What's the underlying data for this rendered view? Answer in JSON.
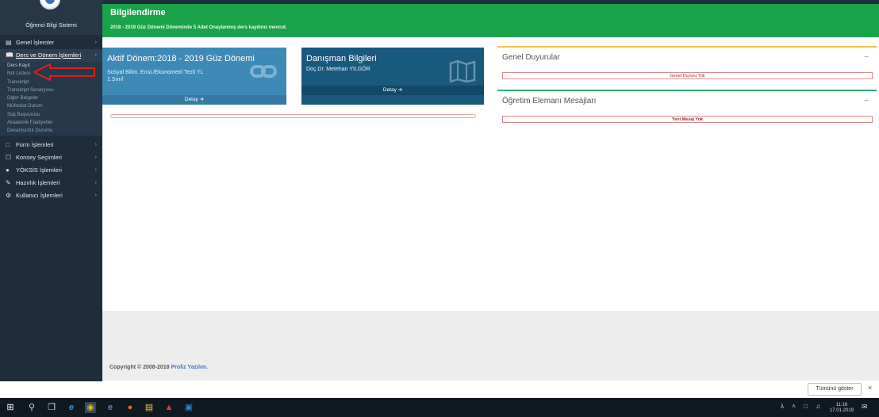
{
  "app": {
    "name": "Öğrenci Bilgi Sistemi"
  },
  "colors": {
    "sidebar": "#1f2d3b",
    "header": "#1aa34a",
    "card_term": "#3d8ab7",
    "card_advisor": "#18597d",
    "announce_accent": "#f0c14b",
    "messages_accent": "#2bb673",
    "annotation": "#e02020"
  },
  "sidebar": {
    "items": [
      {
        "label": "Genel İşlemler",
        "icon": "list-icon"
      },
      {
        "label": "Ders ve Dönem İşlemleri",
        "icon": "book-icon",
        "active": true
      },
      {
        "label": "Form İşlemleri",
        "icon": "form-icon"
      },
      {
        "label": "Konsey Seçimleri",
        "icon": "ballot-icon"
      },
      {
        "label": "YÖKSİS İşlemleri",
        "icon": "users-icon"
      },
      {
        "label": "Hazırlık İşlemleri",
        "icon": "prep-icon"
      },
      {
        "label": "Kullanıcı İşlemleri",
        "icon": "user-gear-icon"
      }
    ],
    "subitems": [
      "Ders Kayıt",
      "Not Listesi",
      "Transkript",
      "Transkript Senaryosu",
      "Diğer Belgeler",
      "Müfredat Durum",
      "Staj Başvurusu",
      "Akademik Faaliyetler",
      "Devamsızlık Durumu"
    ]
  },
  "header": {
    "title": "Bilgilendirme",
    "message": "2018 - 2019 Güz Dönemi Döneminde 5 Adet Onaylanmış ders kaydınız mevcut."
  },
  "cards": {
    "term": {
      "title": "Aktif Dönem:2018 - 2019 Güz Dönemi",
      "line1": "Sosyal Bilim. Enst./Ekonometri Tezli YL",
      "line2": "1.Sınıf",
      "detail": "Detay"
    },
    "advisor": {
      "title": "Danışman Bilgileri",
      "line1": "Doç.Dr. Metehan YILGÖR",
      "detail": "Detay"
    }
  },
  "panels": {
    "announcements": {
      "title": "Genel Duyurular",
      "empty": "Genel Duyuru Yok",
      "collapse": "–"
    },
    "messages": {
      "title": "Öğretim Elemanı Mesajları",
      "empty": "Yeni Mesaj Yok",
      "collapse": "–"
    }
  },
  "footer": {
    "text": "Copyright © 2008-2018 ",
    "brand": "Proliz Yazılım."
  },
  "download_bar": {
    "show_all": "Tümünü göster",
    "close": "×"
  },
  "taskbar": {
    "time": "11:16",
    "date": "17.01.2019"
  }
}
